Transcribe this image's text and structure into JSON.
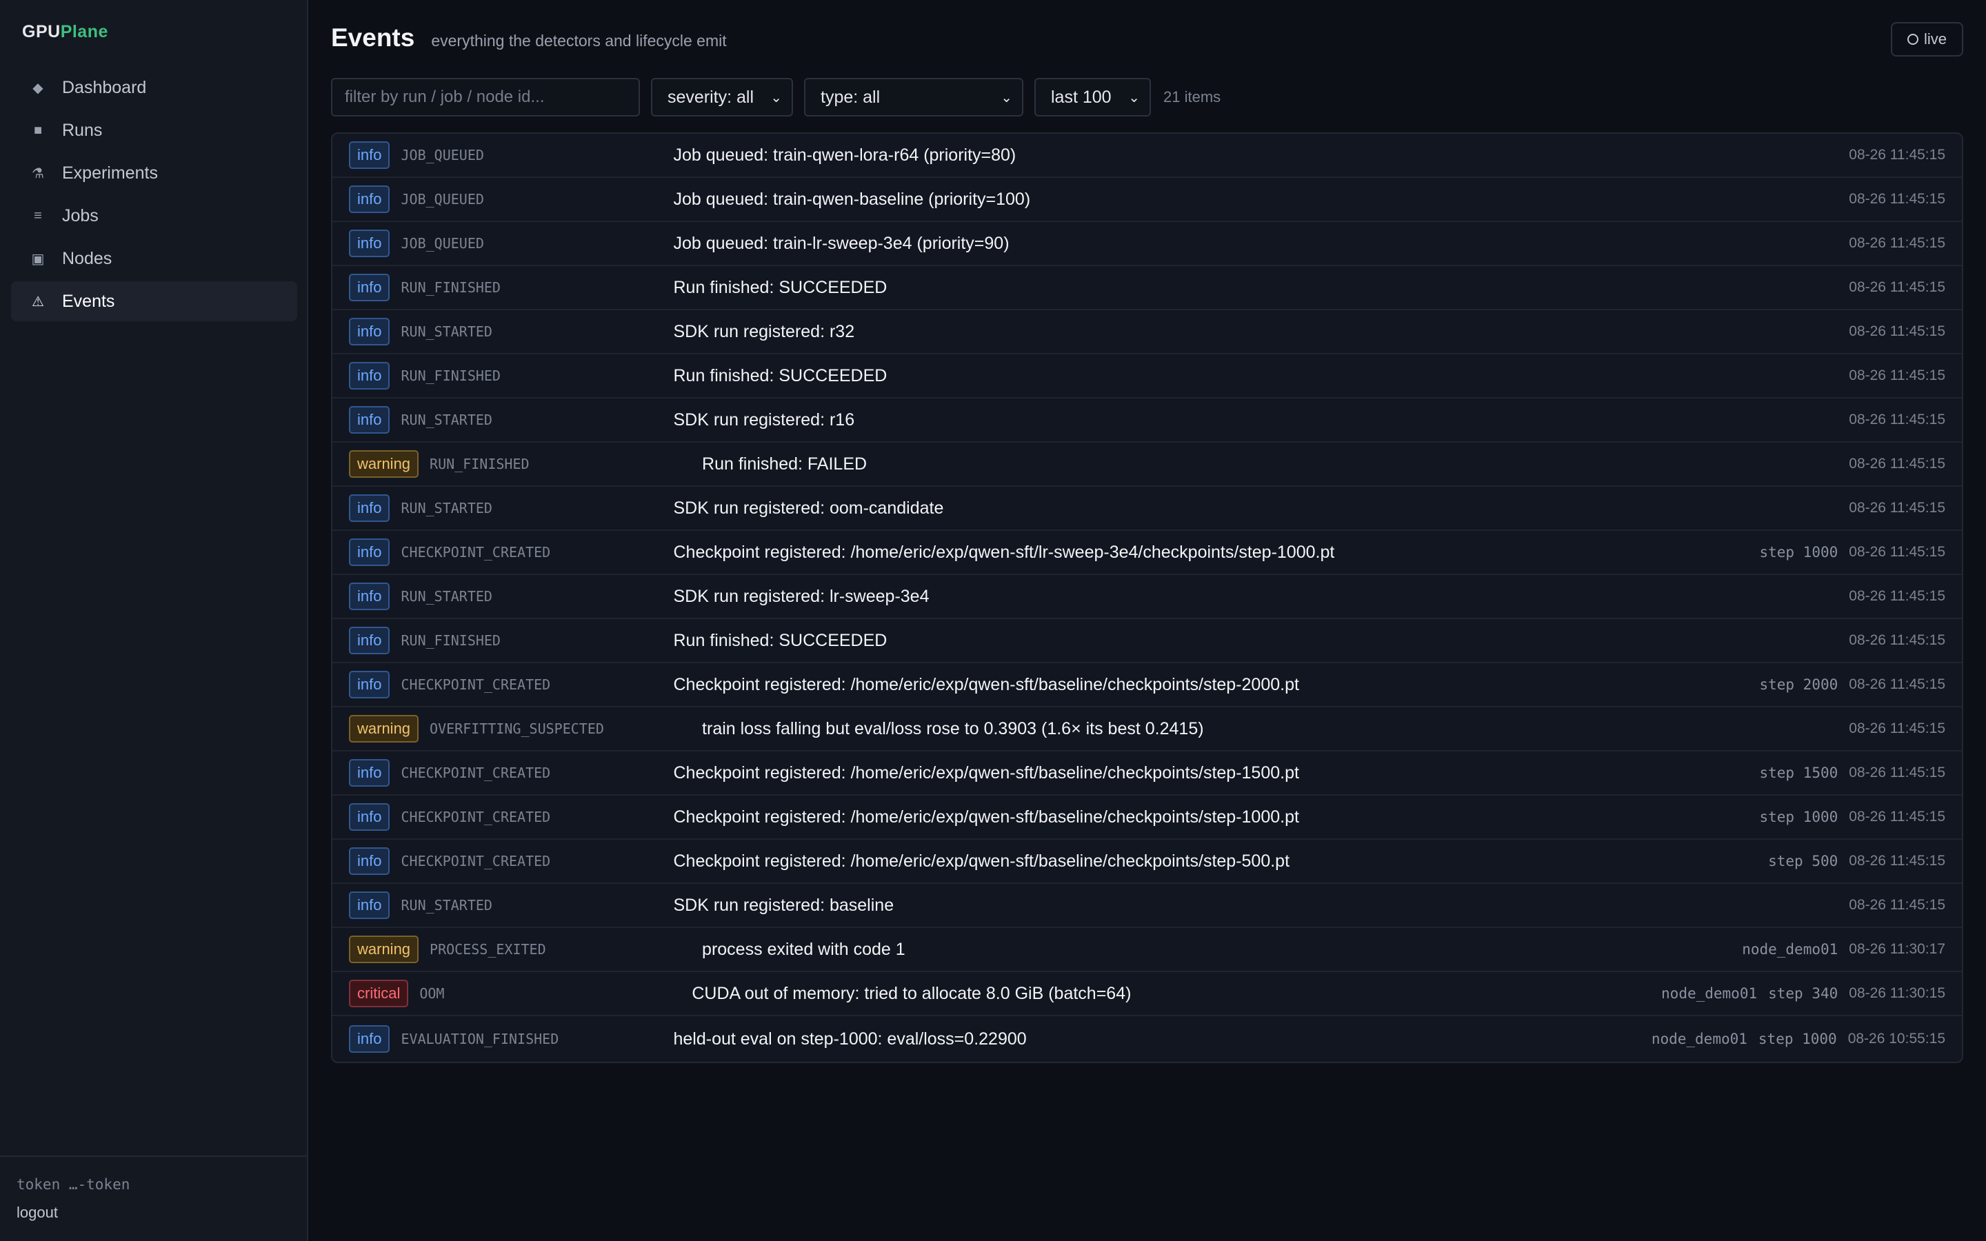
{
  "brand": {
    "prefix": "GPU",
    "suffix": "Plane"
  },
  "nav": [
    {
      "label": "Dashboard",
      "icon": "diamond-icon",
      "glyph": "◆",
      "active": false
    },
    {
      "label": "Runs",
      "icon": "square-icon",
      "glyph": "■",
      "active": false
    },
    {
      "label": "Experiments",
      "icon": "flask-icon",
      "glyph": "⚗",
      "active": false
    },
    {
      "label": "Jobs",
      "icon": "list-icon",
      "glyph": "≡",
      "active": false
    },
    {
      "label": "Nodes",
      "icon": "node-icon",
      "glyph": "▣",
      "active": false
    },
    {
      "label": "Events",
      "icon": "warning-icon",
      "glyph": "⚠",
      "active": true
    }
  ],
  "footer": {
    "token": "token …-token",
    "logout": "logout"
  },
  "header": {
    "title": "Events",
    "subtitle": "everything the detectors and lifecycle emit",
    "live_label": "live"
  },
  "filters": {
    "search_placeholder": "filter by run / job / node id...",
    "severity": "severity: all",
    "type": "type: all",
    "limit": "last 100",
    "count": "21 items"
  },
  "events": [
    {
      "severity": "info",
      "type": "JOB_QUEUED",
      "message": "Job queued: train-qwen-lora-r64 (priority=80)",
      "node": "",
      "step": "",
      "time": "08-26 11:45:15"
    },
    {
      "severity": "info",
      "type": "JOB_QUEUED",
      "message": "Job queued: train-qwen-baseline (priority=100)",
      "node": "",
      "step": "",
      "time": "08-26 11:45:15"
    },
    {
      "severity": "info",
      "type": "JOB_QUEUED",
      "message": "Job queued: train-lr-sweep-3e4 (priority=90)",
      "node": "",
      "step": "",
      "time": "08-26 11:45:15"
    },
    {
      "severity": "info",
      "type": "RUN_FINISHED",
      "message": "Run finished: SUCCEEDED",
      "node": "",
      "step": "",
      "time": "08-26 11:45:15"
    },
    {
      "severity": "info",
      "type": "RUN_STARTED",
      "message": "SDK run registered: r32",
      "node": "",
      "step": "",
      "time": "08-26 11:45:15"
    },
    {
      "severity": "info",
      "type": "RUN_FINISHED",
      "message": "Run finished: SUCCEEDED",
      "node": "",
      "step": "",
      "time": "08-26 11:45:15"
    },
    {
      "severity": "info",
      "type": "RUN_STARTED",
      "message": "SDK run registered: r16",
      "node": "",
      "step": "",
      "time": "08-26 11:45:15"
    },
    {
      "severity": "warning",
      "type": "RUN_FINISHED",
      "message": "Run finished: FAILED",
      "node": "",
      "step": "",
      "time": "08-26 11:45:15"
    },
    {
      "severity": "info",
      "type": "RUN_STARTED",
      "message": "SDK run registered: oom-candidate",
      "node": "",
      "step": "",
      "time": "08-26 11:45:15"
    },
    {
      "severity": "info",
      "type": "CHECKPOINT_CREATED",
      "message": "Checkpoint registered: /home/eric/exp/qwen-sft/lr-sweep-3e4/checkpoints/step-1000.pt",
      "node": "",
      "step": "step 1000",
      "time": "08-26 11:45:15"
    },
    {
      "severity": "info",
      "type": "RUN_STARTED",
      "message": "SDK run registered: lr-sweep-3e4",
      "node": "",
      "step": "",
      "time": "08-26 11:45:15"
    },
    {
      "severity": "info",
      "type": "RUN_FINISHED",
      "message": "Run finished: SUCCEEDED",
      "node": "",
      "step": "",
      "time": "08-26 11:45:15"
    },
    {
      "severity": "info",
      "type": "CHECKPOINT_CREATED",
      "message": "Checkpoint registered: /home/eric/exp/qwen-sft/baseline/checkpoints/step-2000.pt",
      "node": "",
      "step": "step 2000",
      "time": "08-26 11:45:15"
    },
    {
      "severity": "warning",
      "type": "OVERFITTING_SUSPECTED",
      "message": "train loss falling but eval/loss rose to 0.3903 (1.6× its best 0.2415)",
      "node": "",
      "step": "",
      "time": "08-26 11:45:15"
    },
    {
      "severity": "info",
      "type": "CHECKPOINT_CREATED",
      "message": "Checkpoint registered: /home/eric/exp/qwen-sft/baseline/checkpoints/step-1500.pt",
      "node": "",
      "step": "step 1500",
      "time": "08-26 11:45:15"
    },
    {
      "severity": "info",
      "type": "CHECKPOINT_CREATED",
      "message": "Checkpoint registered: /home/eric/exp/qwen-sft/baseline/checkpoints/step-1000.pt",
      "node": "",
      "step": "step 1000",
      "time": "08-26 11:45:15"
    },
    {
      "severity": "info",
      "type": "CHECKPOINT_CREATED",
      "message": "Checkpoint registered: /home/eric/exp/qwen-sft/baseline/checkpoints/step-500.pt",
      "node": "",
      "step": "step 500",
      "time": "08-26 11:45:15"
    },
    {
      "severity": "info",
      "type": "RUN_STARTED",
      "message": "SDK run registered: baseline",
      "node": "",
      "step": "",
      "time": "08-26 11:45:15"
    },
    {
      "severity": "warning",
      "type": "PROCESS_EXITED",
      "message": "process exited with code 1",
      "node": "node_demo01",
      "step": "",
      "time": "08-26 11:30:17"
    },
    {
      "severity": "critical",
      "type": "OOM",
      "message": "CUDA out of memory: tried to allocate 8.0 GiB (batch=64)",
      "node": "node_demo01",
      "step": "step 340",
      "time": "08-26 11:30:15"
    },
    {
      "severity": "info",
      "type": "EVALUATION_FINISHED",
      "message": "held-out eval on step-1000: eval/loss=0.22900",
      "node": "node_demo01",
      "step": "step 1000",
      "time": "08-26 10:55:15"
    }
  ]
}
